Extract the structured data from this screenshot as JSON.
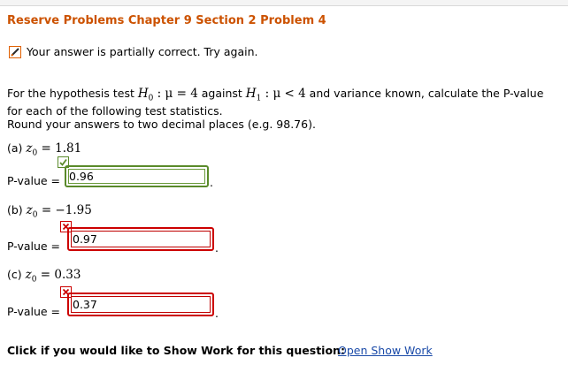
{
  "problem": {
    "title": "Reserve Problems Chapter 9 Section 2 Problem 4",
    "status_text": "Your answer is partially correct.  Try again."
  },
  "question": {
    "intro_prefix": "For the hypothesis test",
    "h0": "H",
    "h0_sub": "0",
    "h0_rel": " : μ = 4",
    "against": " against ",
    "h1": "H",
    "h1_sub": "1",
    "h1_rel": " : μ < 4",
    "intro_suffix": " and variance known, calculate the P-value",
    "line2": "for each of the following test statistics.",
    "line3": "Round your answers to two decimal places (e.g. 98.76)."
  },
  "parts": [
    {
      "label": "(a) ",
      "z_var": "z",
      "z_sub": "0",
      "z_rel": " = 1.81",
      "pvalue_label": "P-value =",
      "answer": "0.96",
      "result": "correct"
    },
    {
      "label": "(b) ",
      "z_var": "z",
      "z_sub": "0",
      "z_rel": " = −1.95",
      "pvalue_label": "P-value =",
      "answer": "0.97",
      "result": "incorrect"
    },
    {
      "label": "(c) ",
      "z_var": "z",
      "z_sub": "0",
      "z_rel": " = 0.33",
      "pvalue_label": "P-value =",
      "answer": "0.37",
      "result": "incorrect"
    }
  ],
  "period": ".",
  "footer": {
    "show_work_prompt": "Click if you would like to Show Work for this question:",
    "show_work_link": "Open Show Work"
  },
  "colors": {
    "title": "#cc5200",
    "correct": "#5a8a2a",
    "incorrect": "#cc0000",
    "link": "#1a4aa8"
  },
  "icons": {
    "status": "pencil-icon",
    "correct": "checkmark-icon",
    "incorrect": "x-mark-icon"
  }
}
